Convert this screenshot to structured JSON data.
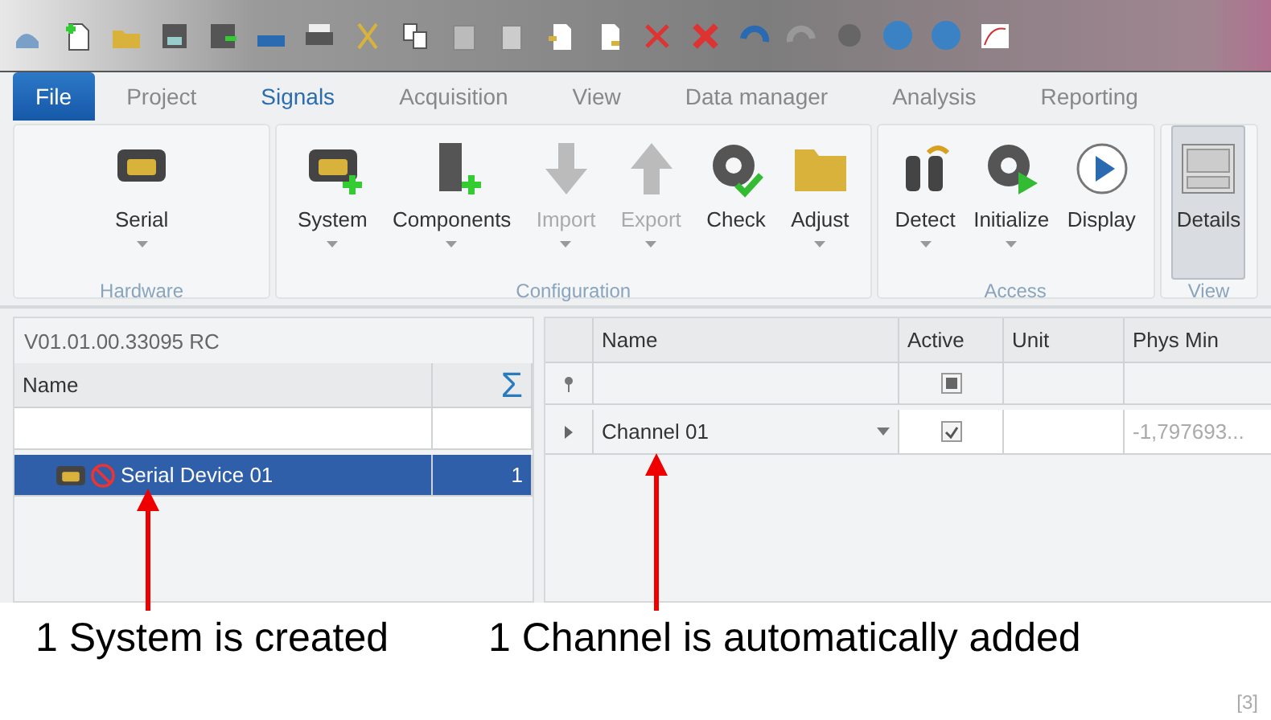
{
  "file_menu": {
    "label": "File"
  },
  "tabs": [
    {
      "label": "Project",
      "selected": false
    },
    {
      "label": "Signals",
      "selected": true
    },
    {
      "label": "Acquisition",
      "selected": false
    },
    {
      "label": "View",
      "selected": false
    },
    {
      "label": "Data manager",
      "selected": false
    },
    {
      "label": "Analysis",
      "selected": false
    },
    {
      "label": "Reporting",
      "selected": false
    }
  ],
  "ribbon": [
    {
      "title": "Hardware",
      "buttons": [
        {
          "label": "Serial",
          "has_menu": true,
          "disabled": false,
          "selected": false
        }
      ]
    },
    {
      "title": "Configuration",
      "buttons": [
        {
          "label": "System",
          "has_menu": true,
          "disabled": false,
          "selected": false
        },
        {
          "label": "Components",
          "has_menu": true,
          "disabled": false,
          "selected": false
        },
        {
          "label": "Import",
          "has_menu": true,
          "disabled": true,
          "selected": false
        },
        {
          "label": "Export",
          "has_menu": true,
          "disabled": true,
          "selected": false
        },
        {
          "label": "Check",
          "has_menu": false,
          "disabled": false,
          "selected": false
        },
        {
          "label": "Adjust",
          "has_menu": true,
          "disabled": false,
          "selected": false
        }
      ]
    },
    {
      "title": "Access",
      "buttons": [
        {
          "label": "Detect",
          "has_menu": true,
          "disabled": false,
          "selected": false
        },
        {
          "label": "Initialize",
          "has_menu": true,
          "disabled": false,
          "selected": false
        },
        {
          "label": "Display",
          "has_menu": false,
          "disabled": false,
          "selected": false
        }
      ]
    },
    {
      "title": "View",
      "buttons": [
        {
          "label": "Details",
          "has_menu": false,
          "disabled": false,
          "selected": true
        }
      ]
    }
  ],
  "left_panel": {
    "version": "V01.01.00.33095 RC",
    "columns": [
      "Name",
      "Σ"
    ],
    "rows": [
      {
        "name": "Serial Device 01",
        "count": "1",
        "selected": true
      }
    ]
  },
  "grid": {
    "columns": [
      "Name",
      "Active",
      "Unit",
      "Phys Min"
    ],
    "filter_indeterminate": true,
    "rows": [
      {
        "name": "Channel 01",
        "active": true,
        "unit": "",
        "phys_min": "-1,797693..."
      }
    ]
  },
  "annotations": [
    "1 System is created",
    "1 Channel is automatically added"
  ],
  "footnote": "[3]"
}
